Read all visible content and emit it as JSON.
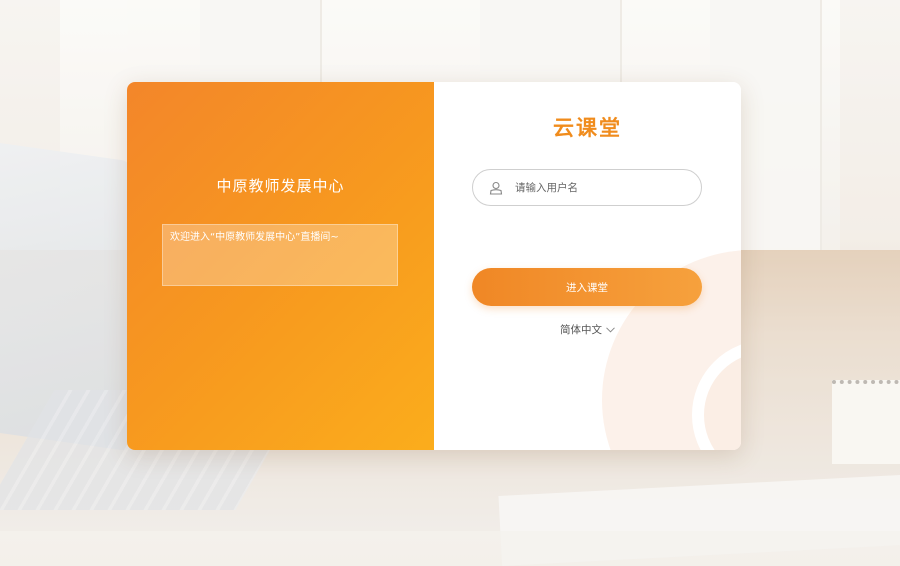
{
  "left_panel": {
    "org_title": "中原教师发展中心",
    "welcome_text": "欢迎进入“中原教师发展中心”直播间~"
  },
  "login": {
    "brand": "云课堂",
    "username_placeholder": "请输入用户名",
    "submit_label": "进入课堂",
    "language_label": "简体中文"
  },
  "icons": {
    "username": "user-icon",
    "language": "chevron-down-icon"
  },
  "colors": {
    "accent": "#f08c1d",
    "left_gradient_start": "#f3862a",
    "left_gradient_end": "#fbad1c",
    "button_start": "#f08725",
    "button_end": "#f6a13d"
  }
}
